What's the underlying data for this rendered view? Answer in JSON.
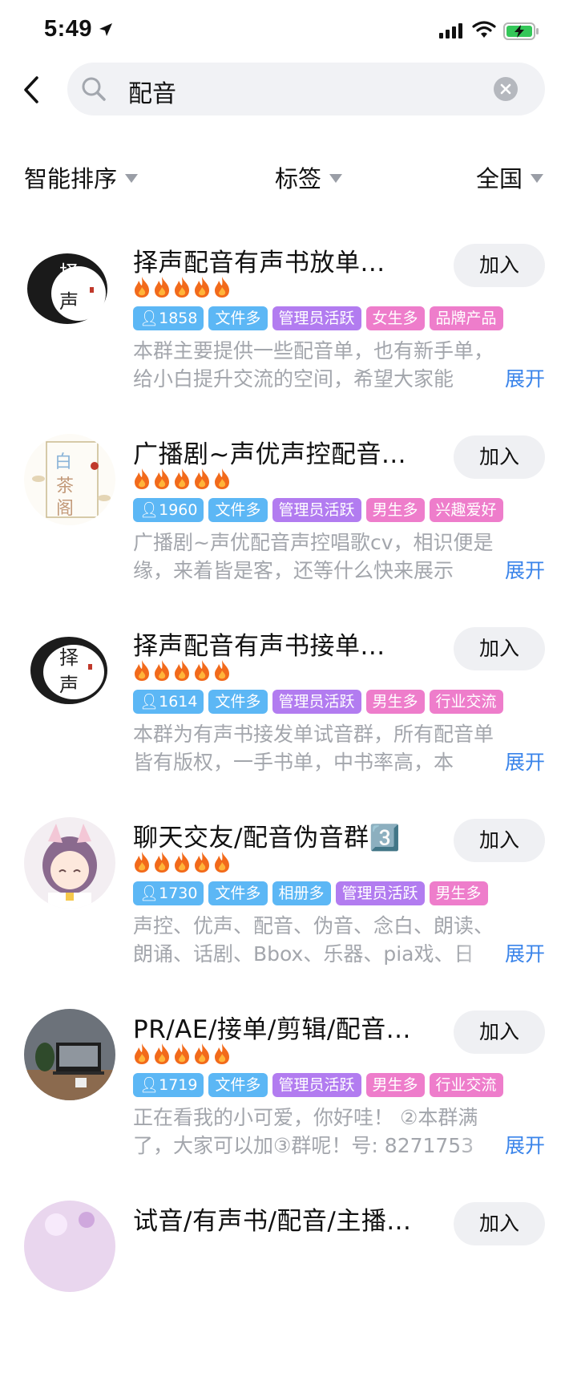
{
  "status_bar": {
    "time": "5:49"
  },
  "search": {
    "query": "配音"
  },
  "filters": [
    {
      "label": "智能排序"
    },
    {
      "label": "标签"
    },
    {
      "label": "全国"
    }
  ],
  "colors": {
    "accent": "#3a84ea",
    "tag_blue": "#5cb7f5",
    "tag_purple": "#b27cf0",
    "tag_pink": "#ee7dcb",
    "flame": "#f26a1b"
  },
  "join_label": "加入",
  "expand_label": "展开",
  "groups": [
    {
      "title": "择声配音有声书放单...",
      "flames": 5,
      "members": "1858",
      "tags": [
        {
          "text": "文件多",
          "color": "blue"
        },
        {
          "text": "管理员活跃",
          "color": "purple"
        },
        {
          "text": "女生多",
          "color": "pink"
        },
        {
          "text": "品牌产品",
          "color": "pink"
        }
      ],
      "desc_line1": "本群主要提供一些配音单，也有新手单，",
      "desc_line2": "给小白提升交流的空间，希望大家能"
    },
    {
      "title": "广播剧~声优声控配音...",
      "flames": 5,
      "members": "1960",
      "tags": [
        {
          "text": "文件多",
          "color": "blue"
        },
        {
          "text": "管理员活跃",
          "color": "purple"
        },
        {
          "text": "男生多",
          "color": "pink"
        },
        {
          "text": "兴趣爱好",
          "color": "pink"
        }
      ],
      "desc_line1": "广播剧~声优配音声控唱歌cv，相识便是",
      "desc_line2": "缘，来着皆是客，还等什么快来展示"
    },
    {
      "title": "择声配音有声书接单...",
      "flames": 5,
      "members": "1614",
      "tags": [
        {
          "text": "文件多",
          "color": "blue"
        },
        {
          "text": "管理员活跃",
          "color": "purple"
        },
        {
          "text": "男生多",
          "color": "pink"
        },
        {
          "text": "行业交流",
          "color": "pink"
        }
      ],
      "desc_line1": "本群为有声书接发单试音群，所有配音单",
      "desc_line2": "皆有版权，一手书单，中书率高，本"
    },
    {
      "title": "聊天交友/配音伪音群3️⃣",
      "flames": 5,
      "members": "1730",
      "tags": [
        {
          "text": "文件多",
          "color": "blue"
        },
        {
          "text": "相册多",
          "color": "blue"
        },
        {
          "text": "管理员活跃",
          "color": "purple"
        },
        {
          "text": "男生多",
          "color": "pink"
        }
      ],
      "desc_line1": "声控、优声、配音、伪音、念白、朗读、",
      "desc_line2": "朗诵、话剧、Bbox、乐器、pia戏、日"
    },
    {
      "title": "PR/AE/接单/剪辑/配音...",
      "flames": 5,
      "members": "1719",
      "tags": [
        {
          "text": "文件多",
          "color": "blue"
        },
        {
          "text": "管理员活跃",
          "color": "purple"
        },
        {
          "text": "男生多",
          "color": "pink"
        },
        {
          "text": "行业交流",
          "color": "pink"
        }
      ],
      "desc_line1": "正在看我的小可爱，你好哇！ ②本群满",
      "desc_line2": "了，大家可以加③群呢！号: 8271753"
    },
    {
      "title": "试音/有声书/配音/主播...",
      "flames": 0,
      "members": "",
      "tags": [],
      "desc_line1": "",
      "desc_line2": ""
    }
  ]
}
